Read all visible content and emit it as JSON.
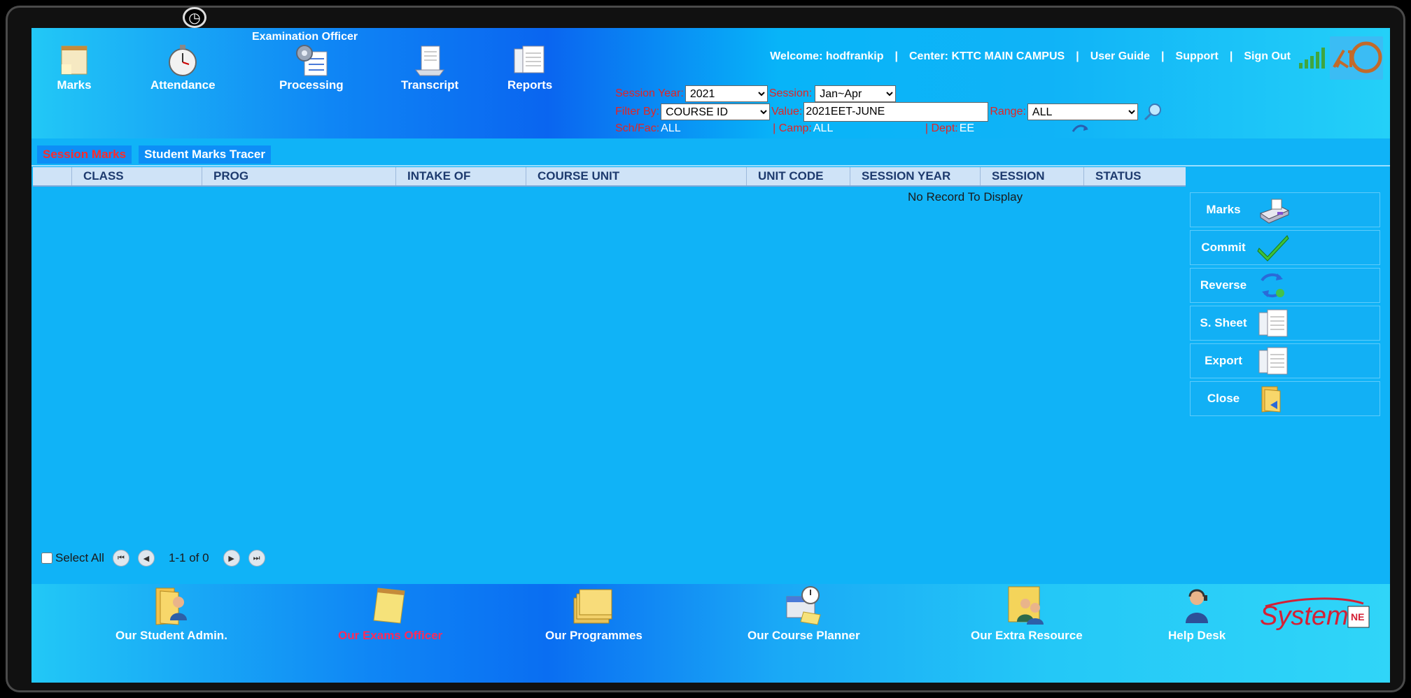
{
  "header": {
    "role_title": "Examination Officer",
    "nav": [
      {
        "label": "Marks",
        "icon": "notepad-icon"
      },
      {
        "label": "Attendance",
        "icon": "stopwatch-icon"
      },
      {
        "label": "Processing",
        "icon": "gear-list-icon"
      },
      {
        "label": "Transcript",
        "icon": "document-stack-icon"
      },
      {
        "label": "Reports",
        "icon": "report-icon"
      }
    ],
    "user": {
      "welcome": "Welcome: hodfrankip",
      "center": "Center: KTTC MAIN CAMPUS",
      "guide": "User Guide",
      "support": "Support",
      "signout": "Sign Out",
      "sep": "|"
    }
  },
  "filters": {
    "session_year_label": "Session Year:",
    "session_year_value": "2021",
    "session_label": "Session:",
    "session_value": "Jan~Apr",
    "filter_by_label": "Filter By:",
    "filter_by_value": "COURSE ID",
    "value_label": "Value:",
    "value_value": "2021EET-JUNE",
    "range_label": "Range:",
    "range_value": "ALL",
    "schfac_label": "Sch/Fac:",
    "schfac_value": "ALL",
    "camp_label": "| Camp:",
    "camp_value": "ALL",
    "dept_label": "| Dept:",
    "dept_value": "EE"
  },
  "tabs": [
    {
      "label": "Session Marks",
      "active": true
    },
    {
      "label": "Student Marks Tracer",
      "active": false
    }
  ],
  "grid": {
    "columns": [
      "CLASS",
      "PROG",
      "INTAKE OF",
      "COURSE UNIT",
      "UNIT CODE",
      "SESSION YEAR",
      "SESSION",
      "STATUS"
    ],
    "empty_text": "No Record To Display"
  },
  "actions": [
    {
      "label": "Marks",
      "icon": "scanner-icon"
    },
    {
      "label": "Commit",
      "icon": "checkmark-icon"
    },
    {
      "label": "Reverse",
      "icon": "reverse-arrows-icon"
    },
    {
      "label": "S. Sheet",
      "icon": "sheet-icon"
    },
    {
      "label": "Export",
      "icon": "export-sheet-icon"
    },
    {
      "label": "Close",
      "icon": "folder-close-icon"
    }
  ],
  "pager": {
    "select_all": "Select All",
    "range_text": "1-1 of 0"
  },
  "footer": {
    "items": [
      {
        "label": "Our Student Admin.",
        "icon": "folder-user-icon",
        "active": false
      },
      {
        "label": "Our Exams Officer",
        "icon": "notepad-icon",
        "active": true
      },
      {
        "label": "Our Programmes",
        "icon": "folders-icon",
        "active": false
      },
      {
        "label": "Our Course Planner",
        "icon": "planner-icon",
        "active": false
      },
      {
        "label": "Our Extra Resource",
        "icon": "users-folder-icon",
        "active": false
      },
      {
        "label": "Help Desk",
        "icon": "helpdesk-icon",
        "active": false
      }
    ],
    "brand": "System"
  },
  "colors": {
    "background": "#10b3f7",
    "accent_red": "#ff2a2a",
    "label_red": "#e42424",
    "grid_header": "#cfe3f7"
  }
}
